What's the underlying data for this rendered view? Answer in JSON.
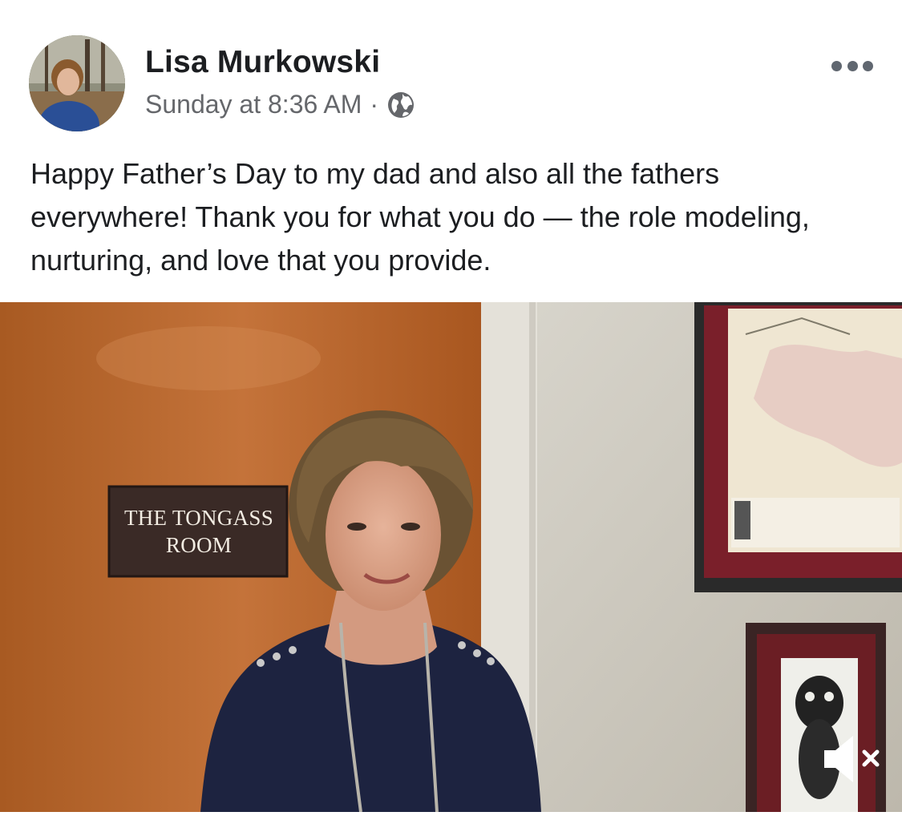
{
  "post": {
    "author": "Lisa Murkowski",
    "timestamp": "Sunday at 8:36 AM",
    "separator": "·",
    "audience_icon": "globe-icon",
    "caption": "Happy Father’s Day to my dad and also all the fathers everywhere! Thank you for what you do — the role modeling, nurturing, and love that you provide.",
    "more_icon": "more-options-icon"
  },
  "media": {
    "type": "video",
    "sign_line1": "THE TONGASS",
    "sign_line2": "ROOM",
    "sound_icon": "speaker-muted-icon"
  },
  "colors": {
    "text_primary": "#1c1e21",
    "text_secondary": "#65676b",
    "door": "#b8672c",
    "sign": "#3a2a26",
    "frame": "#7a1f2a"
  }
}
